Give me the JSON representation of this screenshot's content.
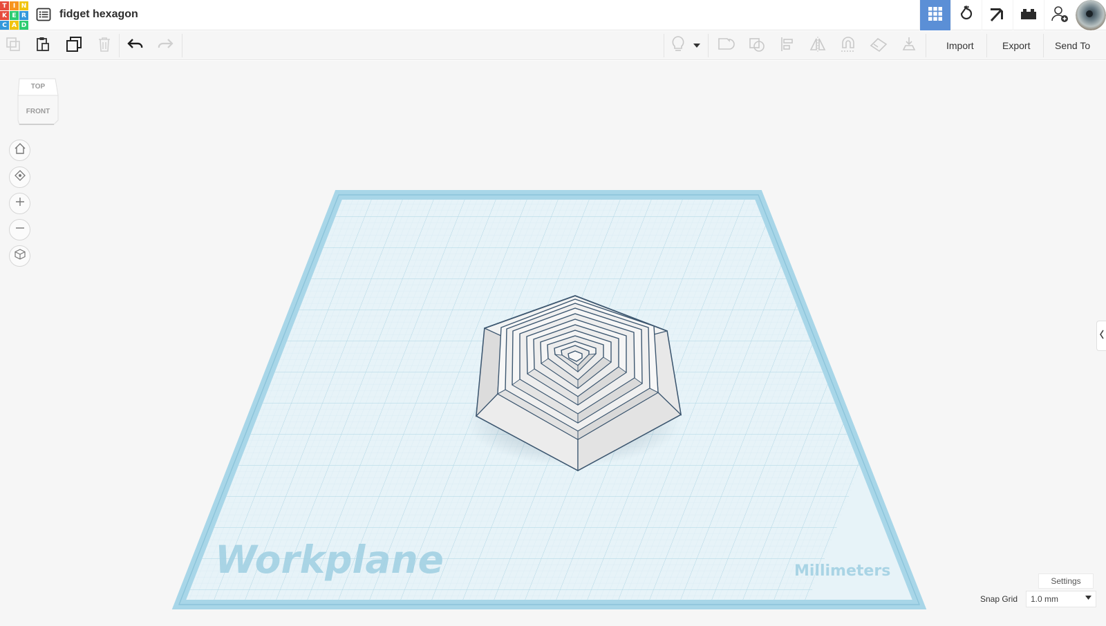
{
  "app": {
    "logo_letters": [
      "T",
      "I",
      "N",
      "K",
      "E",
      "R",
      "C",
      "A",
      "D"
    ],
    "logo_colors": [
      "#e64b3c",
      "#f7941d",
      "#f1c40f",
      "#e64b3c",
      "#2ecc71",
      "#3498db",
      "#3498db",
      "#f1c40f",
      "#2ecc71"
    ],
    "design_name": "fidget hexagon"
  },
  "header": {
    "buttons": [
      {
        "name": "3d-design-view-icon",
        "active": true
      },
      {
        "name": "circuits-view-icon",
        "active": false
      },
      {
        "name": "minecraft-pickaxe-icon",
        "active": false
      },
      {
        "name": "brick-view-icon",
        "active": false
      },
      {
        "name": "add-user-icon",
        "active": false
      }
    ]
  },
  "toolbar": {
    "import_label": "Import",
    "export_label": "Export",
    "send_to_label": "Send To"
  },
  "viewcube": {
    "top_label": "TOP",
    "front_label": "FRONT"
  },
  "workplane": {
    "label": "Workplane",
    "units_label": "Millimeters"
  },
  "bottom": {
    "settings_label": "Settings",
    "snap_grid_label": "Snap Grid",
    "snap_grid_value": "1.0 mm"
  },
  "colors": {
    "accent": "#5b8fd6",
    "grid_fill": "#e3f2f8",
    "grid_border": "#a8d6e8",
    "shape_stroke": "#3d5770"
  }
}
